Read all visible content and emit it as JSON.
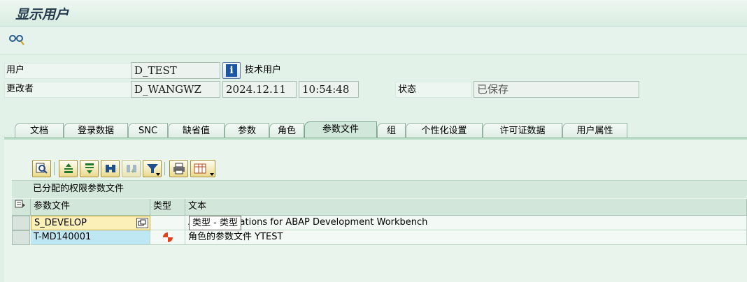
{
  "title": "显示用户",
  "toolbar": {
    "glasses_icon": "glasses-icon"
  },
  "header": {
    "user_label": "用户",
    "user_value": "D_TEST",
    "user_type": "技术用户",
    "changed_by_label": "更改者",
    "changed_by_value": "D_WANGWZ",
    "date": "2024.12.11",
    "time": "10:54:48",
    "status_label": "状态",
    "status_value": "已保存"
  },
  "tabs": [
    "文档",
    "登录数据",
    "SNC",
    "缺省值",
    "参数",
    "角色",
    "参数文件",
    "组",
    "个性化设置",
    "许可证数据",
    "用户属性"
  ],
  "active_tab": "参数文件",
  "grid": {
    "title": "已分配的权限参数文件",
    "columns": [
      "参数文件",
      "类型",
      "文本"
    ],
    "rows": [
      {
        "profile": "S_DEVELOP",
        "type": "",
        "text": "All authorizations for ABAP Development Workbench"
      },
      {
        "profile": "T-MD140001",
        "type": "role-profile-icon",
        "text": "角色的参数文件 YTEST"
      }
    ],
    "tooltip": "类型 - 类型"
  },
  "colors": {
    "background": "#dff0e6",
    "highlight_row": "#bfe6f3",
    "selected_cell": "#fbf0b8"
  }
}
